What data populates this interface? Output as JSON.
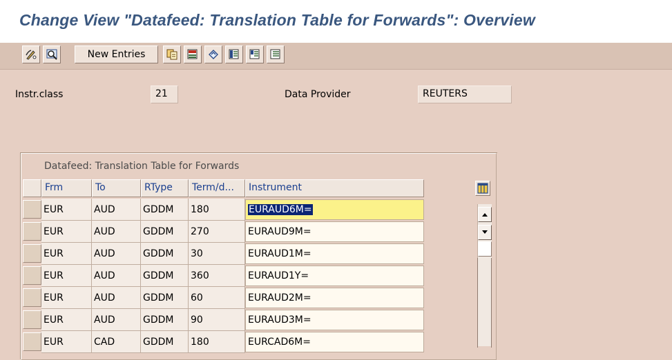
{
  "title": "Change View \"Datafeed: Translation Table for Forwards\": Overview",
  "toolbar": {
    "buttons": [
      {
        "icon": "display-change-icon"
      },
      {
        "icon": "details-icon"
      },
      {
        "label": "New Entries"
      },
      {
        "icon": "copy-as-icon"
      },
      {
        "icon": "delete-icon"
      },
      {
        "icon": "undo-change-icon"
      },
      {
        "icon": "select-all-icon"
      },
      {
        "icon": "select-block-icon"
      },
      {
        "icon": "deselect-all-icon"
      }
    ]
  },
  "header_fields": {
    "instr_class_label": "Instr.class",
    "instr_class_value": "21",
    "data_provider_label": "Data Provider",
    "data_provider_value": "REUTERS"
  },
  "table": {
    "title": "Datafeed: Translation Table for Forwards",
    "columns": [
      "Frm",
      "To",
      "RType",
      "Term/d...",
      "Instrument"
    ],
    "rows": [
      {
        "frm": "EUR",
        "to": "AUD",
        "rtype": "GDDM",
        "term": "180",
        "instrument": "EURAUD6M="
      },
      {
        "frm": "EUR",
        "to": "AUD",
        "rtype": "GDDM",
        "term": "270",
        "instrument": "EURAUD9M="
      },
      {
        "frm": "EUR",
        "to": "AUD",
        "rtype": "GDDM",
        "term": "30",
        "instrument": "EURAUD1M="
      },
      {
        "frm": "EUR",
        "to": "AUD",
        "rtype": "GDDM",
        "term": "360",
        "instrument": "EURAUD1Y="
      },
      {
        "frm": "EUR",
        "to": "AUD",
        "rtype": "GDDM",
        "term": "60",
        "instrument": "EURAUD2M="
      },
      {
        "frm": "EUR",
        "to": "AUD",
        "rtype": "GDDM",
        "term": "90",
        "instrument": "EURAUD3M="
      },
      {
        "frm": "EUR",
        "to": "CAD",
        "rtype": "GDDM",
        "term": "180",
        "instrument": "EURCAD6M="
      }
    ],
    "active_row": 0
  },
  "colors": {
    "background": "#e6cfc3",
    "title_text": "#3a577f",
    "header_text": "#1a3f8f",
    "active_cell": "#fbf28a",
    "selection": "#0a2474"
  }
}
